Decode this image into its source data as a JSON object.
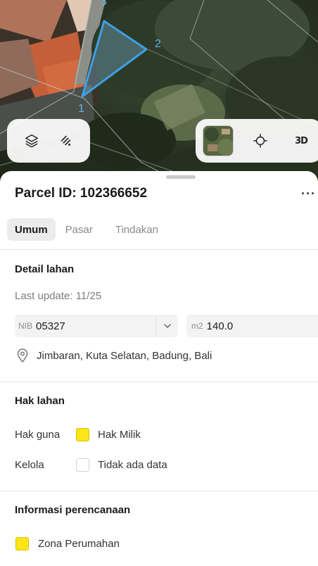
{
  "map": {
    "vertex_labels": [
      "1",
      "2",
      "3"
    ],
    "parcel_color": "#3da0e6",
    "controls": {
      "layers": "layers-icon",
      "draw": "draw-icon",
      "basemap": "satellite-thumbnail",
      "locate": "crosshair-icon",
      "three_d": "3D"
    }
  },
  "sheet": {
    "parcel_title": "Parcel ID: 102366652",
    "more": "···",
    "tabs": [
      {
        "label": "Umum",
        "active": true
      },
      {
        "label": "Pasar",
        "active": false
      },
      {
        "label": "Tindakan",
        "active": false
      }
    ],
    "detail": {
      "title": "Detail lahan",
      "last_update": "Last update: 11/25",
      "nib_prefix": "NIB",
      "nib_value": "05327",
      "area_prefix": "m2",
      "area_value": "140.0",
      "location": "Jimbaran, Kuta Selatan, Badung, Bali"
    },
    "rights": {
      "title": "Hak lahan",
      "rows": [
        {
          "label": "Hak guna",
          "value": "Hak Milik",
          "color": "#fde517",
          "filled": true
        },
        {
          "label": "Kelola",
          "value": "Tidak ada data",
          "color": "#ffffff",
          "filled": false
        }
      ]
    },
    "planning": {
      "title": "Informasi perencanaan",
      "zone": "Zona Perumahan",
      "zone_color": "#fde517"
    }
  }
}
